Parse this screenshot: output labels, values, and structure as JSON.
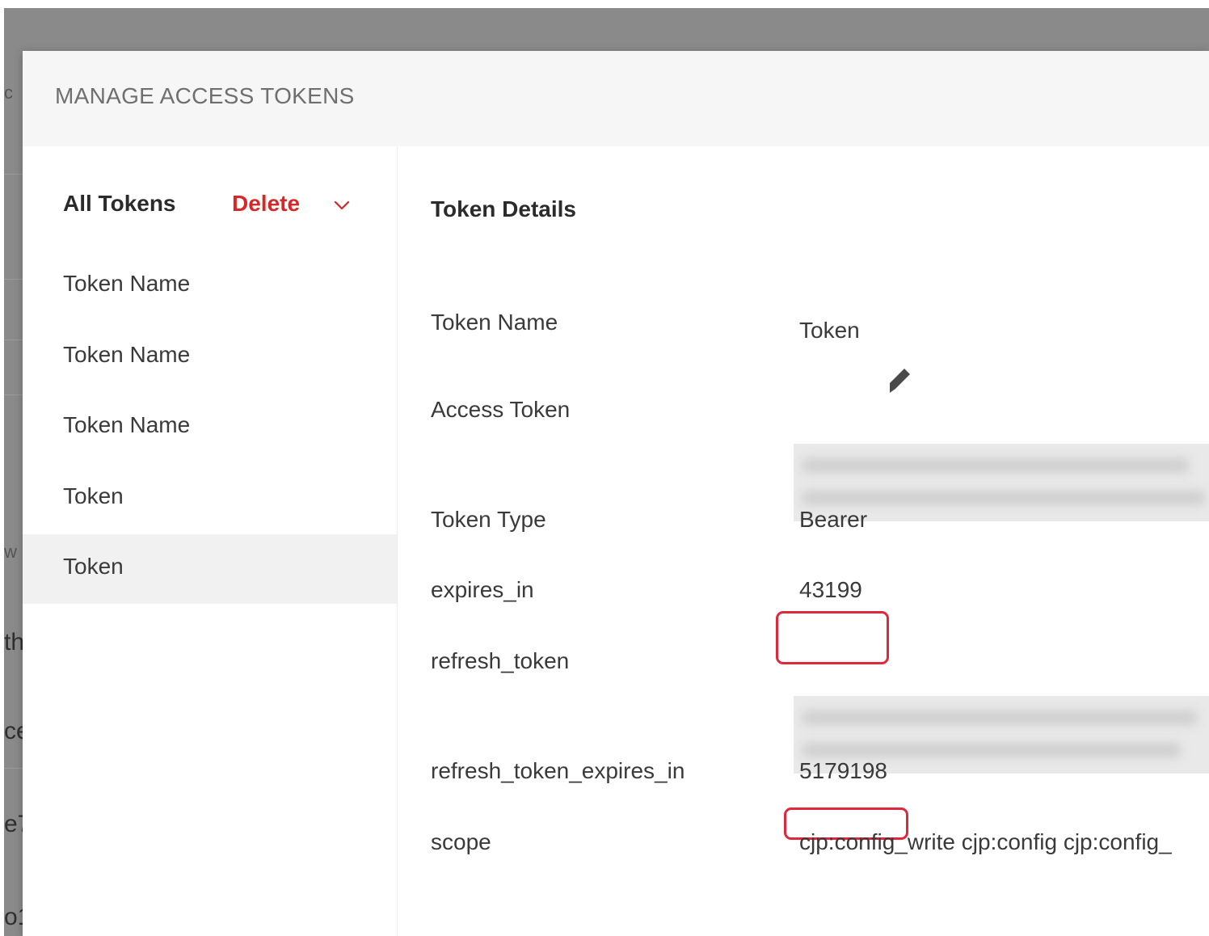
{
  "background": {
    "fragments": [
      "c",
      "w",
      "th",
      "ce",
      "e7",
      "o1"
    ]
  },
  "modal": {
    "title": "MANAGE ACCESS TOKENS"
  },
  "token_list": {
    "header": "All Tokens",
    "delete_label": "Delete",
    "items": [
      {
        "label": "Token Name"
      },
      {
        "label": "Token Name"
      },
      {
        "label": "Token Name"
      },
      {
        "label": "Token"
      },
      {
        "label": "Token"
      }
    ]
  },
  "details": {
    "title": "Token Details",
    "fields": {
      "token_name": {
        "label": "Token Name",
        "value": "Token"
      },
      "access_token": {
        "label": "Access Token"
      },
      "token_type": {
        "label": "Token Type",
        "value": "Bearer"
      },
      "expires_in": {
        "label": "expires_in",
        "value": "43199"
      },
      "refresh_token": {
        "label": "refresh_token"
      },
      "refresh_token_expires_in": {
        "label": "refresh_token_expires_in",
        "value": "5179198"
      },
      "scope": {
        "label": "scope",
        "value": "cjp:config_write cjp:config cjp:config_"
      }
    }
  },
  "colors": {
    "accent_red": "#d62828",
    "highlight_red": "#e0283c",
    "backdrop": "#8a8a8a"
  }
}
